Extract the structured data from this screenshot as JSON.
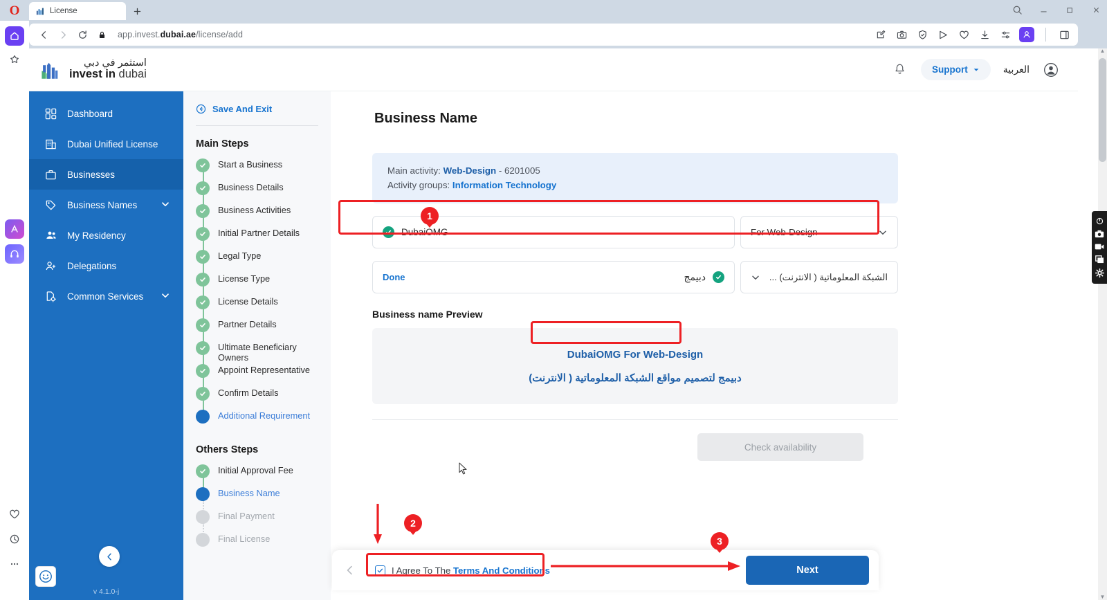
{
  "browser": {
    "tab_title": "License",
    "tab_favicon": "chart-bars-icon",
    "new_tab_label": "+",
    "url_prefix": "app.invest.",
    "url_domain": "dubai.ae",
    "url_path": "/license/add",
    "controls": {
      "back": "back-arrow-icon",
      "forward": "forward-arrow-icon",
      "reload": "reload-icon",
      "lock": "lock-icon",
      "search": "search-icon",
      "minimize": "minimize-icon",
      "maximize": "maximize-icon",
      "close": "close-icon"
    },
    "extensions": [
      "edit-icon",
      "camera-icon",
      "shield-check-icon",
      "send-icon",
      "heart-icon",
      "download-icon",
      "sliders-icon",
      "profile-icon"
    ],
    "sidebar_icons": [
      "home-icon",
      "star-icon",
      "app-colorful-icon",
      "headphones-icon",
      "heart-icon",
      "history-clock-icon",
      "more-dots-icon"
    ]
  },
  "header": {
    "logo_arabic": "استثمر في دبي",
    "logo_en_bold": "invest in",
    "logo_en_light": "dubai",
    "bell": "notification-bell-icon",
    "support_label": "Support",
    "language_label": "العربية",
    "avatar": "user-avatar-icon"
  },
  "sidebar": {
    "items": [
      {
        "label": "Dashboard",
        "icon": "grid-icon",
        "active": false,
        "expandable": false
      },
      {
        "label": "Dubai Unified License",
        "icon": "building-icon",
        "active": false,
        "expandable": false
      },
      {
        "label": "Businesses",
        "icon": "briefcase-icon",
        "active": true,
        "expandable": false
      },
      {
        "label": "Business Names",
        "icon": "tag-icon",
        "active": false,
        "expandable": true
      },
      {
        "label": "My Residency",
        "icon": "people-icon",
        "active": false,
        "expandable": false
      },
      {
        "label": "Delegations",
        "icon": "user-add-icon",
        "active": false,
        "expandable": false
      },
      {
        "label": "Common Services",
        "icon": "file-gear-icon",
        "active": false,
        "expandable": true
      }
    ],
    "collapse_icon": "chevron-left-icon",
    "version": "v 4.1.0-j"
  },
  "steps_panel": {
    "save_and_exit": "Save And Exit",
    "main_steps_title": "Main Steps",
    "main_steps": [
      {
        "label": "Start a Business",
        "state": "done"
      },
      {
        "label": "Business Details",
        "state": "done"
      },
      {
        "label": "Business Activities",
        "state": "done"
      },
      {
        "label": "Initial Partner Details",
        "state": "done"
      },
      {
        "label": "Legal Type",
        "state": "done"
      },
      {
        "label": "License Type",
        "state": "done"
      },
      {
        "label": "License Details",
        "state": "done"
      },
      {
        "label": "Partner Details",
        "state": "done"
      },
      {
        "label": "Ultimate Beneficiary Owners",
        "state": "done"
      },
      {
        "label": "Appoint Representative",
        "state": "done"
      },
      {
        "label": "Confirm Details",
        "state": "done"
      },
      {
        "label": "Additional Requirement",
        "state": "current"
      }
    ],
    "others_steps_title": "Others Steps",
    "others_steps": [
      {
        "label": "Initial Approval Fee",
        "state": "done"
      },
      {
        "label": "Business Name",
        "state": "current"
      },
      {
        "label": "Final Payment",
        "state": "todo"
      },
      {
        "label": "Final License",
        "state": "todo"
      }
    ]
  },
  "main": {
    "page_title": "Business Name",
    "activity": {
      "main_activity_label": "Main activity:",
      "main_activity_value": "Web-Design",
      "main_activity_code": "- 6201005",
      "activity_groups_label": "Activity groups:",
      "activity_groups_value": "Information Technology"
    },
    "name_en": {
      "value": "DubaiOMG",
      "status_icon": "check-circle-icon",
      "suffix_selected": "For Web-Design",
      "chevron": "chevron-down-icon"
    },
    "name_ar": {
      "value": "دبيمج",
      "status_icon": "check-circle-icon",
      "done_label": "Done",
      "suffix_selected": "الشبكة المعلوماتية ( الانترنت) ...",
      "chevron": "chevron-down-icon"
    },
    "preview_title": "Business name Preview",
    "preview_en": "DubaiOMG For Web-Design",
    "preview_ar": "دبيمج لتصميم مواقع الشبكة المعلوماتية ( الانترنت)",
    "check_availability_label": "Check availability"
  },
  "action_bar": {
    "back_icon": "chevron-left-icon",
    "checkbox_checked": true,
    "agree_prefix": "I Agree To The ",
    "terms_link": "Terms And Conditions",
    "next_label": "Next"
  },
  "annotations": [
    {
      "number": "1",
      "target": "business-name-english-field"
    },
    {
      "number": "2",
      "target": "terms-checkbox"
    },
    {
      "number": "3",
      "target": "next-button"
    }
  ],
  "recorder_widget": {
    "icons": [
      "recorder-menu-icon",
      "screenshot-camera-icon",
      "record-video-icon",
      "capture-window-icon",
      "recorder-settings-gear-icon"
    ]
  },
  "colors": {
    "brand_blue": "#1d6fc0",
    "accent_link": "#1673cf",
    "done_green": "#7fc49a",
    "annotation_red": "#ed2024",
    "next_button": "#1a66b5"
  }
}
